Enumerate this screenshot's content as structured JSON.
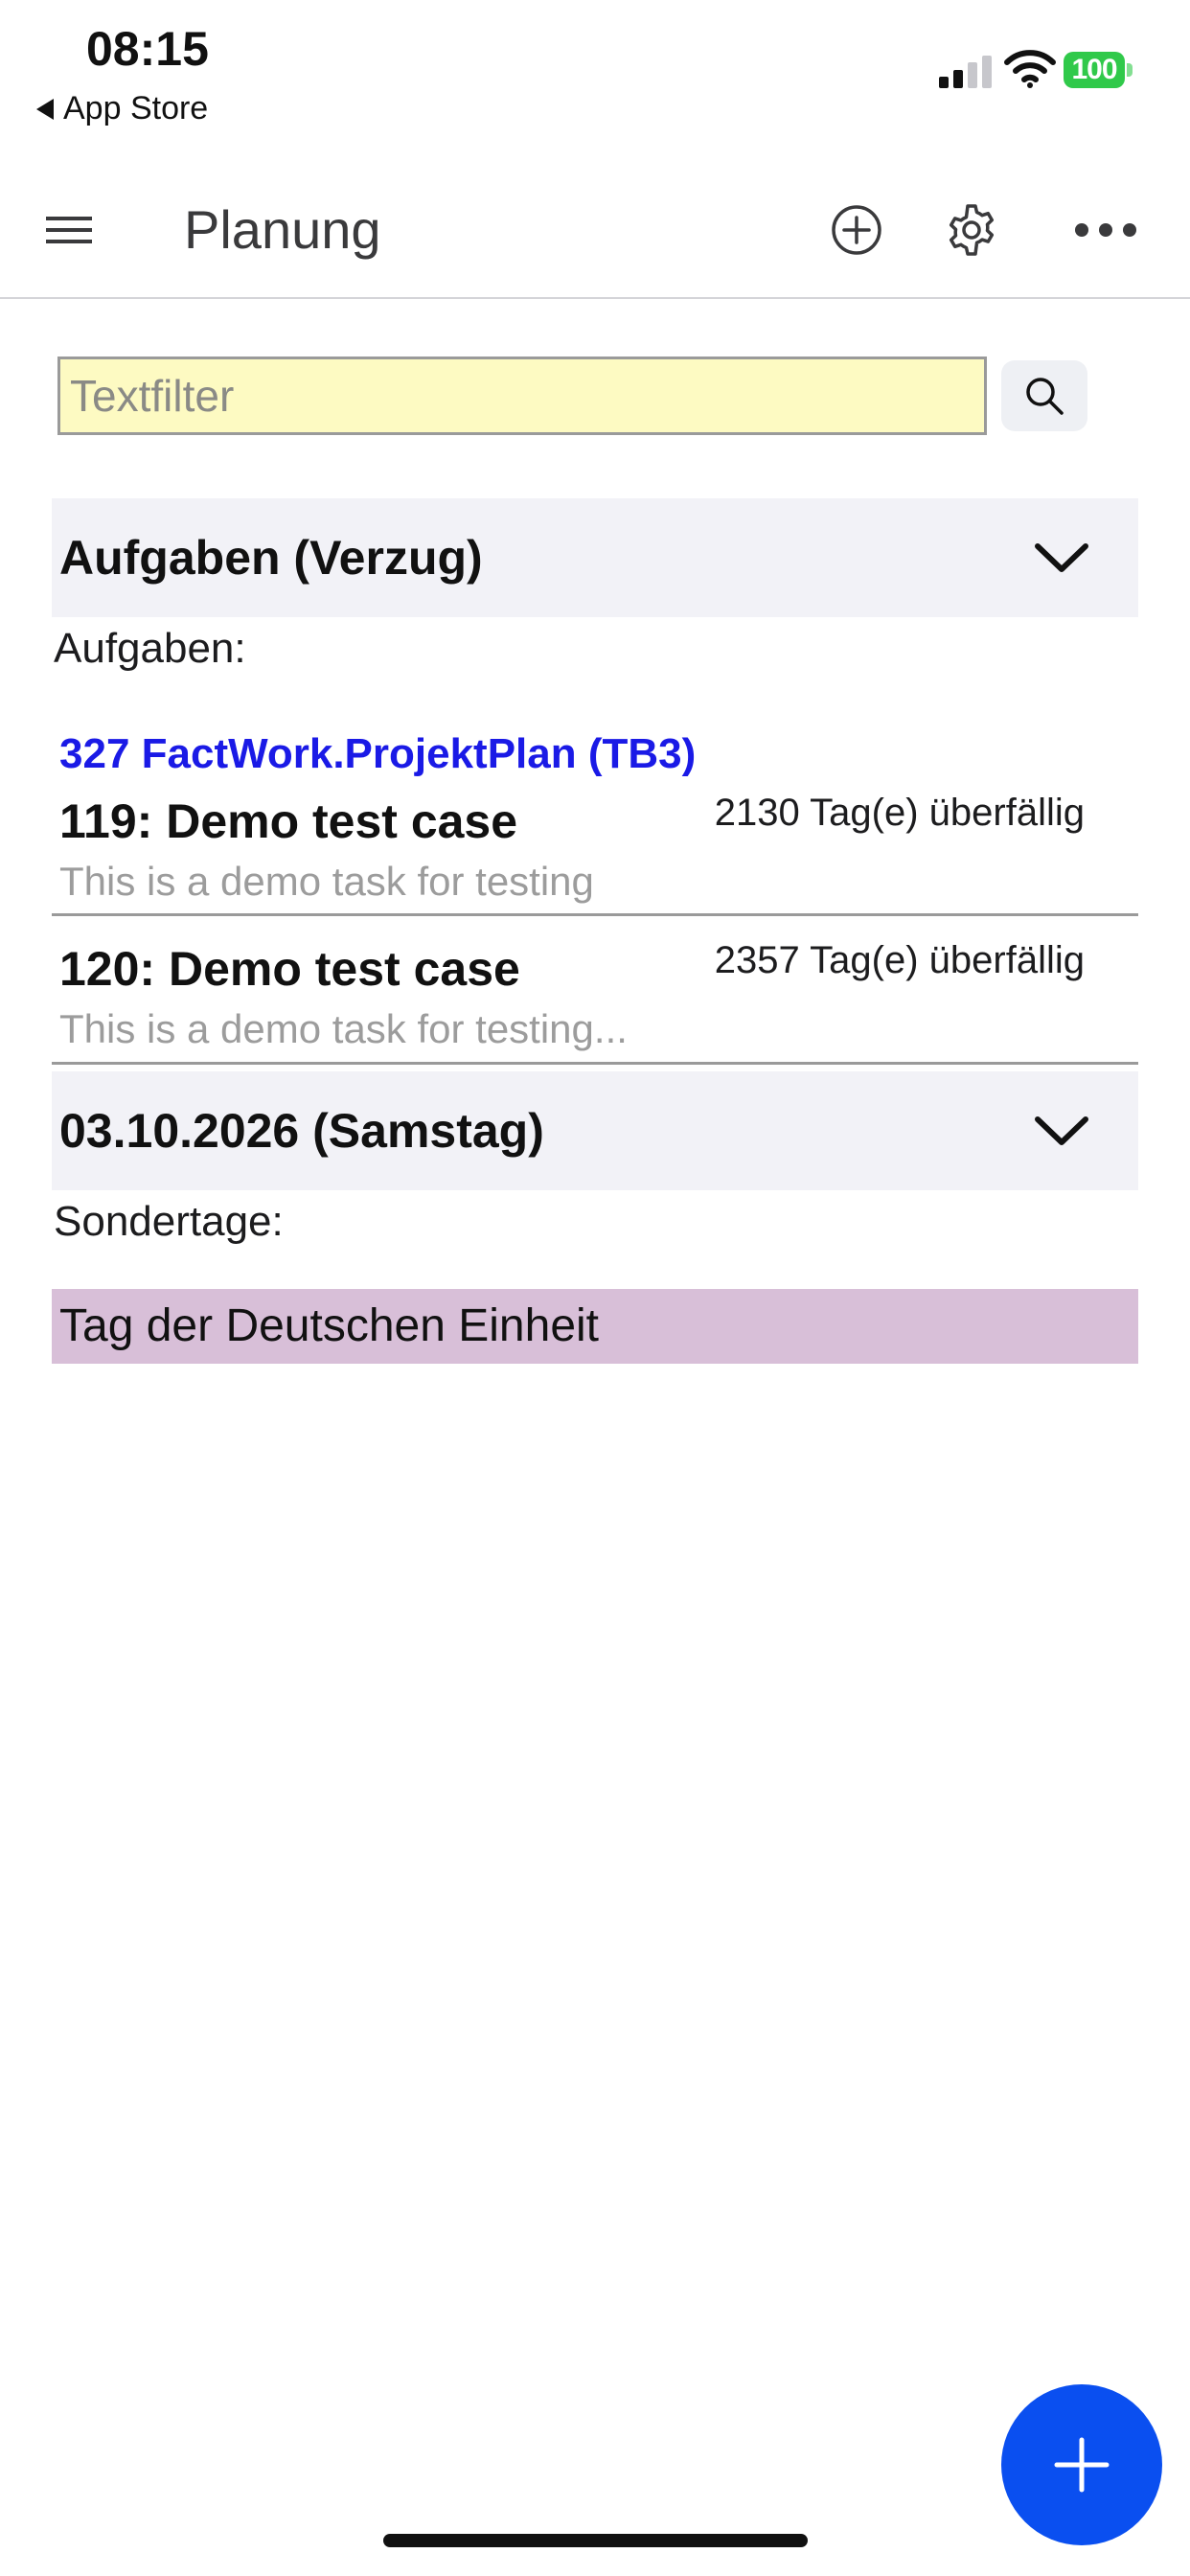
{
  "status_bar": {
    "time": "08:15",
    "back_label": "App Store",
    "battery": "100",
    "battery_color": "#30c94a"
  },
  "toolbar": {
    "title": "Planung",
    "icons": [
      "menu-icon",
      "add-circle-icon",
      "gear-icon",
      "more-icon"
    ]
  },
  "filter": {
    "placeholder": "Textfilter",
    "value": ""
  },
  "sections": {
    "overdue": {
      "title": "Aufgaben (Verzug)",
      "label": "Aufgaben:",
      "project": "327 FactWork.ProjektPlan (TB3)",
      "tasks": [
        {
          "title": "119: Demo test case",
          "overdue": "2130 Tag(e) überfällig",
          "description": "This is a demo task for testing"
        },
        {
          "title": "120: Demo test case",
          "overdue": "2357 Tag(e) überfällig",
          "description": "This is a demo task for testing..."
        }
      ]
    },
    "date": {
      "title": "03.10.2026 (Samstag)",
      "label": "Sondertage:",
      "special_day": "Tag der Deutschen Einheit",
      "special_day_color": "#d8bfd8"
    }
  },
  "colors": {
    "accent": "#0a4ff0",
    "link": "#1a1ae6",
    "filter_background": "#fdfac2",
    "section_background": "#f2f2f7"
  }
}
